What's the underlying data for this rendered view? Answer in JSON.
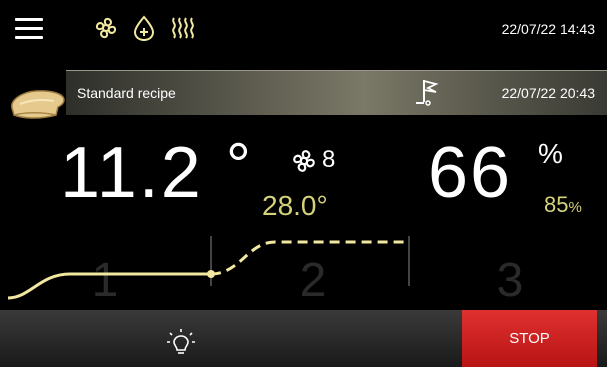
{
  "header": {
    "datetime": "22/07/22 14:43",
    "status_icons": [
      "fan-icon",
      "humidity-drop-icon",
      "heating-icon"
    ]
  },
  "recipe": {
    "name": "Standard recipe",
    "end_datetime": "22/07/22 20:43",
    "icon": "bread-loaf-icon",
    "end_icon": "finish-flag-icon"
  },
  "readings": {
    "temperature": "11.2",
    "temperature_unit": "°",
    "temperature_setpoint": "28.0°",
    "fan_speed": "8",
    "humidity": "66",
    "humidity_unit": "%",
    "humidity_setpoint": "85",
    "humidity_setpoint_unit": "%"
  },
  "phases": {
    "labels": [
      "1",
      "2",
      "3"
    ],
    "current": 1
  },
  "controls": {
    "light_icon": "light-bulb-icon",
    "stop_label": "STOP"
  },
  "colors": {
    "accent_yellow": "#f2e8a0",
    "setpoint_text": "#d6d27a",
    "stop_red": "#d42020",
    "background": "#000000"
  }
}
